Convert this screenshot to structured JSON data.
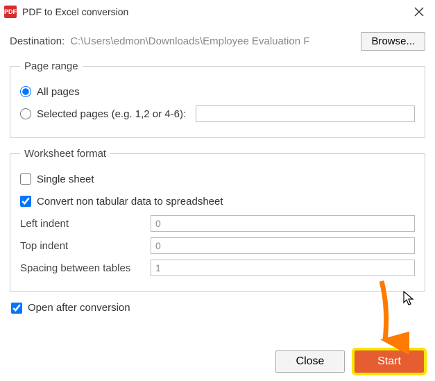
{
  "window": {
    "title": "PDF to Excel conversion",
    "app_icon_label": "PDF"
  },
  "destination": {
    "label": "Destination:",
    "path": "C:\\Users\\edmon\\Downloads\\Employee Evaluation F",
    "browse_label": "Browse..."
  },
  "page_range": {
    "legend": "Page range",
    "all_pages_label": "All pages",
    "selected_pages_label": "Selected pages (e.g. 1,2 or 4-6):",
    "selected_pages_value": ""
  },
  "worksheet_format": {
    "legend": "Worksheet format",
    "single_sheet_label": "Single sheet",
    "convert_non_tabular_label": "Convert non tabular data to spreadsheet",
    "left_indent_label": "Left indent",
    "left_indent_value": "0",
    "top_indent_label": "Top indent",
    "top_indent_value": "0",
    "spacing_label": "Spacing between tables",
    "spacing_value": "1"
  },
  "open_after": {
    "label": "Open after conversion"
  },
  "footer": {
    "close_label": "Close",
    "start_label": "Start"
  }
}
